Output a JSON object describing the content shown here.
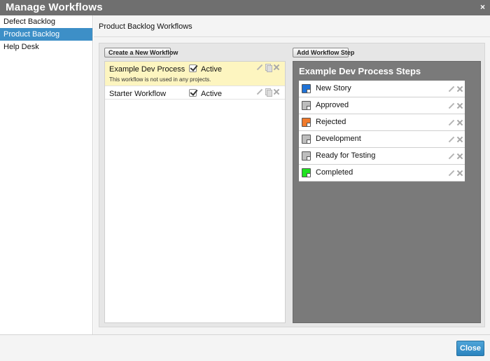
{
  "window": {
    "title": "Manage Workflows",
    "close_glyph": "×"
  },
  "sidebar": {
    "items": [
      {
        "label": "Defect Backlog",
        "selected": false
      },
      {
        "label": "Product Backlog",
        "selected": true
      },
      {
        "label": "Help Desk",
        "selected": false
      }
    ]
  },
  "main": {
    "heading": "Product Backlog Workflows",
    "create_button": "Create a New Workflow",
    "add_step_button": "Add Workflow Step"
  },
  "workflows": [
    {
      "name": "Example Dev Process",
      "active_label": "Active",
      "active": true,
      "note": "This workflow is not used in any projects.",
      "selected": true
    },
    {
      "name": "Starter Workflow",
      "active_label": "Active",
      "active": true,
      "note": "",
      "selected": false
    }
  ],
  "steps_panel": {
    "title": "Example Dev Process Steps",
    "steps": [
      {
        "label": "New Story",
        "color": "#1f72d6"
      },
      {
        "label": "Approved",
        "color": "#bdbdbd"
      },
      {
        "label": "Rejected",
        "color": "#f07a2b"
      },
      {
        "label": "Development",
        "color": "#bdbdbd"
      },
      {
        "label": "Ready for Testing",
        "color": "#bdbdbd"
      },
      {
        "label": "Completed",
        "color": "#1fe21f"
      }
    ]
  },
  "icons": {
    "edit": "pencil-icon",
    "copy": "copy-icon",
    "delete": "delete-icon"
  },
  "footer": {
    "close_button": "Close"
  }
}
